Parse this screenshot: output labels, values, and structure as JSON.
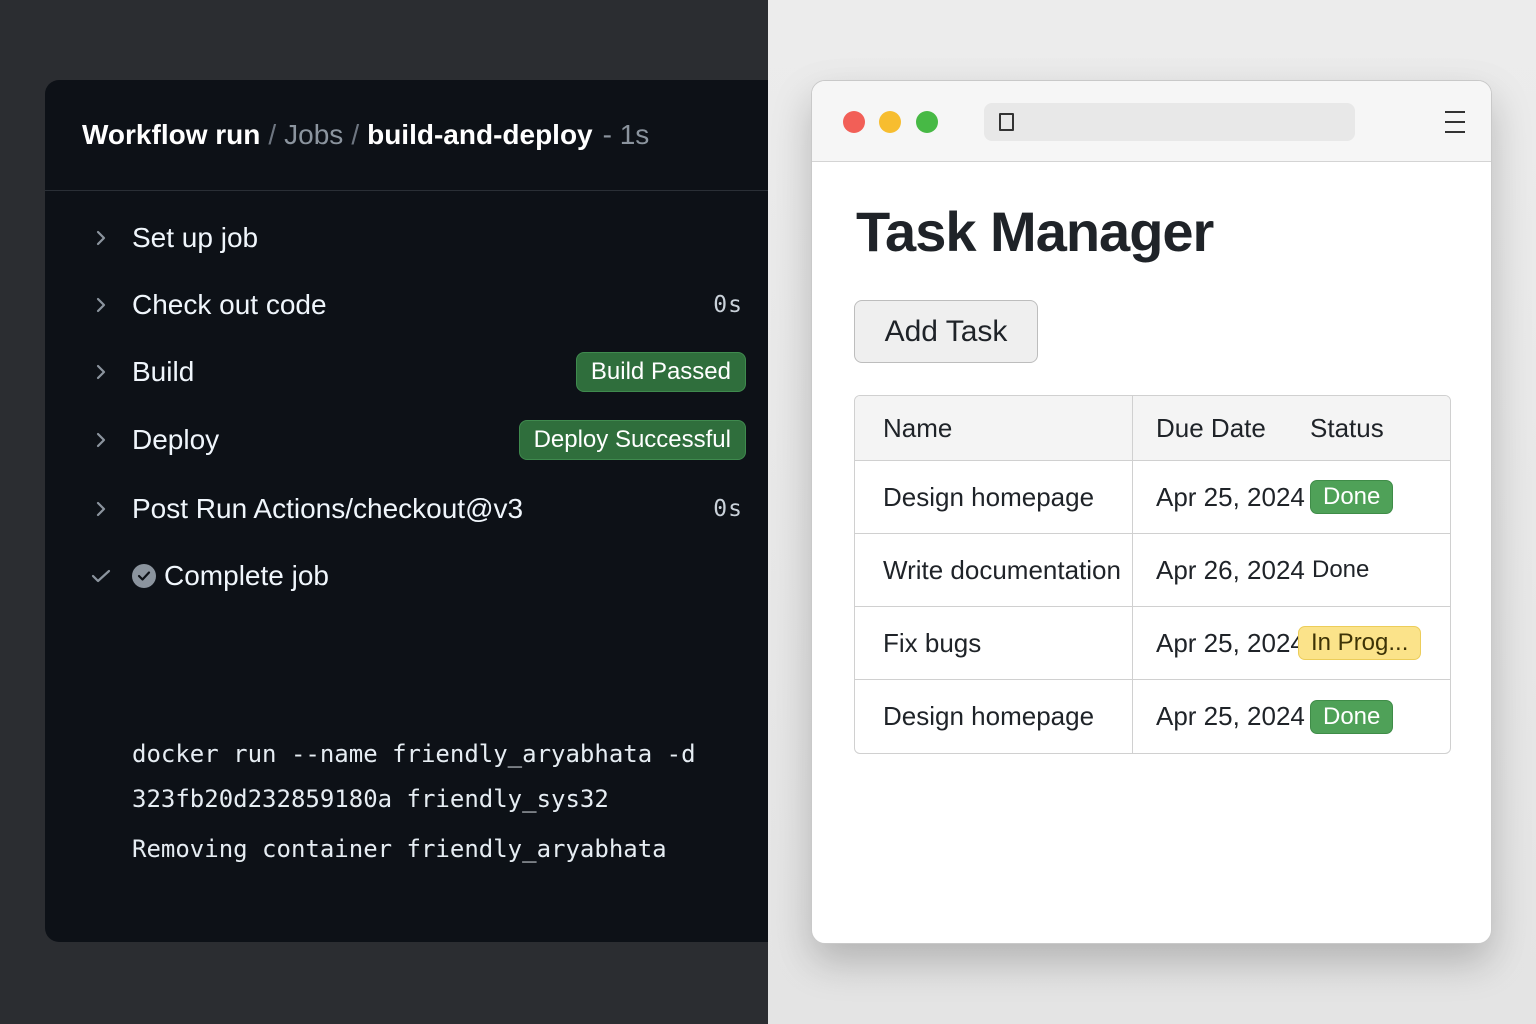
{
  "workflow": {
    "breadcrumb": {
      "root": "Workflow run",
      "sep1": "/",
      "jobs": "Jobs",
      "sep2": "/",
      "job": "build-and-deploy",
      "duration": "- 1s"
    },
    "steps": [
      {
        "label": "Set up job",
        "time": "",
        "badge": ""
      },
      {
        "label": "Check out code",
        "time": "0s",
        "badge": ""
      },
      {
        "label": "Build",
        "time": "",
        "badge": "Build Passed"
      },
      {
        "label": "Deploy",
        "time": "",
        "badge": "Deploy Successful"
      },
      {
        "label": "Post Run Actions/checkout@v3",
        "time": "0s",
        "badge": ""
      },
      {
        "label": "Complete job",
        "time": "",
        "badge": ""
      }
    ],
    "log_lines": [
      "docker run --name friendly_aryabhata -d",
      "323fb20d232859180a friendly_sys32",
      "Removing container friendly_aryabhata"
    ]
  },
  "browser": {
    "title": "Task Manager",
    "add_button": "Add Task",
    "columns": [
      "Name",
      "Due Date",
      "Status"
    ],
    "rows": [
      {
        "name": "Design homepage",
        "due": "Apr 25, 2024",
        "status": "Done"
      },
      {
        "name": "Write documentation",
        "due": "Apr 26, 2024",
        "status": "Done"
      },
      {
        "name": "Fix bugs",
        "due": "Apr 25, 2024",
        "status": "In Prog..."
      },
      {
        "name": "Design homepage",
        "due": "Apr 25, 2024",
        "status": "Done"
      }
    ]
  },
  "colors": {
    "terminal_bg": "#0d1117",
    "badge_green": "#2f6e3c",
    "done_green": "#4fa158",
    "in_progress_yellow": "#fbe38a"
  },
  "icons": {
    "step_expand": "chevron-right-icon",
    "step_done": "checkmark-icon",
    "complete": "check-circle-icon",
    "menu": "hamburger-menu-icon",
    "window_controls": [
      "close-dot",
      "minimize-dot",
      "zoom-dot"
    ]
  }
}
